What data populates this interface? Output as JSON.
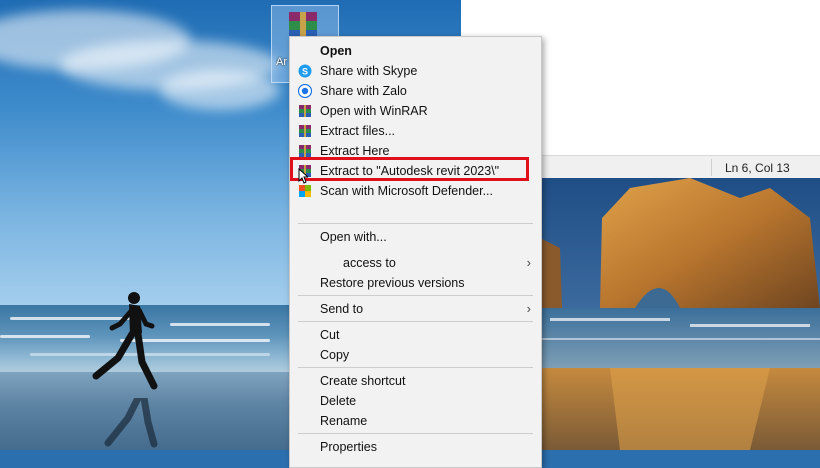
{
  "desktop_icon": {
    "label": "Ar re",
    "icon": "winrar-archive-icon"
  },
  "notepad": {
    "status_position": "Ln 6, Col 13"
  },
  "context_menu": {
    "items": [
      {
        "label": "Open",
        "icon": "",
        "bold": true
      },
      {
        "label": "Share with Skype",
        "icon": "skype-icon"
      },
      {
        "label": "Share with Zalo",
        "icon": "zalo-icon"
      },
      {
        "label": "Open with WinRAR",
        "icon": "winrar-icon"
      },
      {
        "label": "Extract files...",
        "icon": "winrar-icon"
      },
      {
        "label": "Extract Here",
        "icon": "winrar-icon"
      },
      {
        "label": "Extract to \"Autodesk revit 2023\\\"",
        "icon": "winrar-icon",
        "highlighted": true
      },
      {
        "label": "Scan with Microsoft Defender...",
        "icon": "defender-icon"
      },
      {
        "label": "Open with...",
        "icon": ""
      },
      {
        "label": "access to",
        "icon": "",
        "submenu": true
      },
      {
        "label": "Restore previous versions",
        "icon": ""
      },
      {
        "label": "Send to",
        "icon": "",
        "submenu": true
      },
      {
        "label": "Cut",
        "icon": ""
      },
      {
        "label": "Copy",
        "icon": ""
      },
      {
        "label": "Create shortcut",
        "icon": ""
      },
      {
        "label": "Delete",
        "icon": ""
      },
      {
        "label": "Rename",
        "icon": ""
      },
      {
        "label": "Properties",
        "icon": ""
      }
    ],
    "submenu_arrow": "›"
  },
  "colors": {
    "highlight_border": "#e0101a",
    "menu_bg": "#f2f2f2"
  }
}
